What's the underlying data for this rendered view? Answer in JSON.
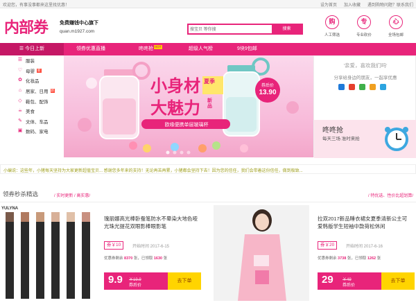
{
  "topbar": {
    "welcome": "欢迎您，有事没事都来这里找优惠！",
    "links": [
      "设为首页",
      "加入收藏",
      "遇到购物问题？联系我们"
    ]
  },
  "header": {
    "logo": "内部券",
    "slogan": "免费赚钱中心旗下",
    "domain": "quan.m1927.com",
    "search_placeholder": "搜宝贝 等你搜",
    "search_button": "搜索",
    "features": [
      {
        "char": "购",
        "label": "人工筛选"
      },
      {
        "char": "专",
        "label": "专业砍价"
      },
      {
        "char": "心",
        "label": "全场包邮"
      }
    ]
  },
  "nav": {
    "category": "☰  今日上新",
    "items": [
      "领券优惠直播",
      "咚咚抢",
      "超级人气榜",
      "9块9包邮"
    ],
    "hot_badge": "HOT"
  },
  "sidebar": {
    "items": [
      {
        "icon": "☰",
        "label": "服装",
        "badge": ""
      },
      {
        "icon": "♡",
        "label": "母婴",
        "badge": "新"
      },
      {
        "icon": "✿",
        "label": "化妆品",
        "badge": ""
      },
      {
        "icon": "⌂",
        "label": "居家、日用",
        "badge": "新"
      },
      {
        "icon": "◇",
        "label": "鞋包、配饰",
        "badge": ""
      },
      {
        "icon": "☕",
        "label": "美食",
        "badge": ""
      },
      {
        "icon": "✎",
        "label": "文体、车品",
        "badge": ""
      },
      {
        "icon": "▣",
        "label": "数码、家电",
        "badge": ""
      }
    ]
  },
  "banner": {
    "headline1": "小身材",
    "headline2": "大魅力",
    "new_label": "新品",
    "tag": "夏季",
    "caption": "欧缘便携单层玻璃杯",
    "price_label": "券后价",
    "price": "13.90"
  },
  "right": {
    "greeting": "'亲爱，喜欢我们吗'",
    "share_text": "分享给身边的朋友，一起享优惠",
    "ddq_title": "咚咚抢",
    "ddq_sub": "每天三场 准时来抢"
  },
  "notice": "小编说：这些年，小猪每天坚持为大家更新超值宝贝... 感谢您多年来的支持！无论再苦再累，小猪都会坚持下去！因为您的信任，我们会带着这份信任，做到极致...",
  "section": {
    "title": "领券秒杀精选",
    "sub": "/ 实时更新 / 高实惠/",
    "right": "/ 特优选、性价比超划算/"
  },
  "products": [
    {
      "title": "瑰丽娜高光棒卧蚕笔防水不晕染大地色哑光珠光提花双眼影棒眼影笔",
      "coupon": "券￥10",
      "date": "开始时间 2017-6-15",
      "sold": "8370",
      "remain": "1630",
      "brand": "YULYNA",
      "price": "9.9",
      "old_price": "￥19.9",
      "price_tag": "券后价",
      "buy": "去下单"
    },
    {
      "title": "拉双2017新品睡衣裙女夏季清新公主可爱韩版学生短袖中款荷松休闲",
      "coupon": "券￥20",
      "date": "开始时间 2017-6-16",
      "sold": "3738",
      "remain": "1262",
      "brand": "",
      "price": "29",
      "old_price": "￥49",
      "price_tag": "券后价",
      "buy": "去下单"
    }
  ],
  "sales_labels": {
    "sold": "优惠券剩余",
    "sold_suffix": "张，已领取",
    "remain_suffix": "张"
  },
  "colors": {
    "accent": "#e8247a",
    "nav_dark": "#c51765",
    "yellow": "#ffd400"
  }
}
